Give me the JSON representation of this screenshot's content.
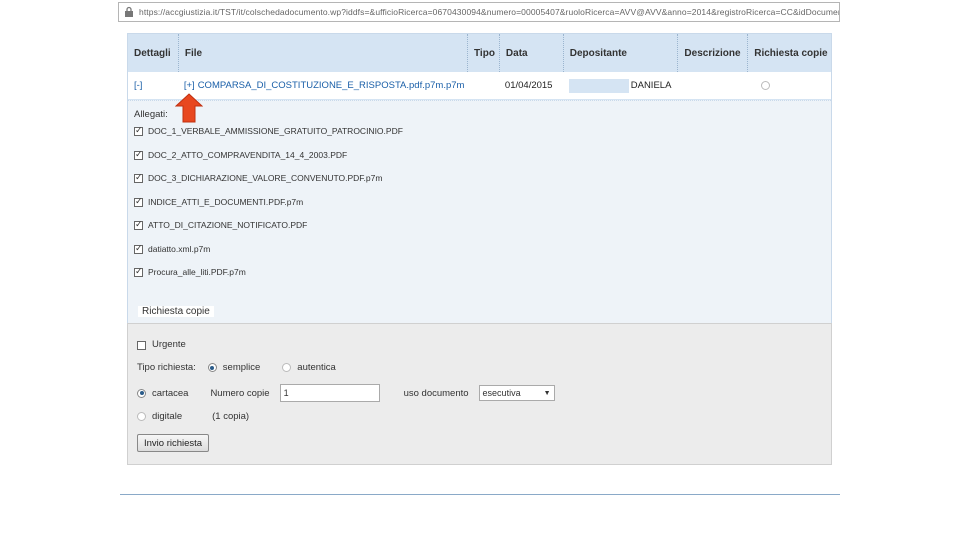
{
  "browser": {
    "url": "https://accgiustizia.it/TST/it/colschedadocumento.wp?iddfs=&ufficioRicerca=0670430094&numero=00005407&ruoloRicerca=AVV@AVV&anno=2014&registroRicerca=CC&idDocumentoRicerca"
  },
  "grid": {
    "headers": [
      "Dettagli",
      "File",
      "Tipo",
      "Data",
      "Depositante",
      "Descrizione",
      "Richiesta copie"
    ],
    "row": {
      "toggle": "[-]",
      "file_toggle": "[+]",
      "file_name": "COMPARSA_DI_COSTITUZIONE_E_RISPOSTA.pdf.p7m.p7m",
      "date": "01/04/2015",
      "depositor": "DANIELA"
    },
    "attachments_title": "Allegati:",
    "attachments": [
      "DOC_1_VERBALE_AMMISSIONE_GRATUITO_PATROCINIO.PDF",
      "DOC_2_ATTO_COMPRAVENDITA_14_4_2003.PDF",
      "DOC_3_DICHIARAZIONE_VALORE_CONVENUTO.PDF.p7m",
      "INDICE_ATTI_E_DOCUMENTI.PDF.p7m",
      "ATTO_DI_CITAZIONE_NOTIFICATO.PDF",
      "datiatto.xml.p7m",
      "Procura_alle_liti.PDF.p7m"
    ]
  },
  "request": {
    "section_title": "Richiesta copie",
    "urgent_label": "Urgente",
    "type_label": "Tipo richiesta:",
    "type_simple": "semplice",
    "type_authentic": "autentica",
    "paper_label": "cartacea",
    "copies_label": "Numero copie",
    "copies_value": "1",
    "use_label": "uso documento",
    "use_value": "esecutiva",
    "digital_label": "digitale",
    "digital_note": "(1 copia)",
    "submit_label": "Invio richiesta"
  },
  "colors": {
    "header_bg": "#d5e4f3",
    "link": "#1a5fa8",
    "arrow": "#e8471f"
  }
}
